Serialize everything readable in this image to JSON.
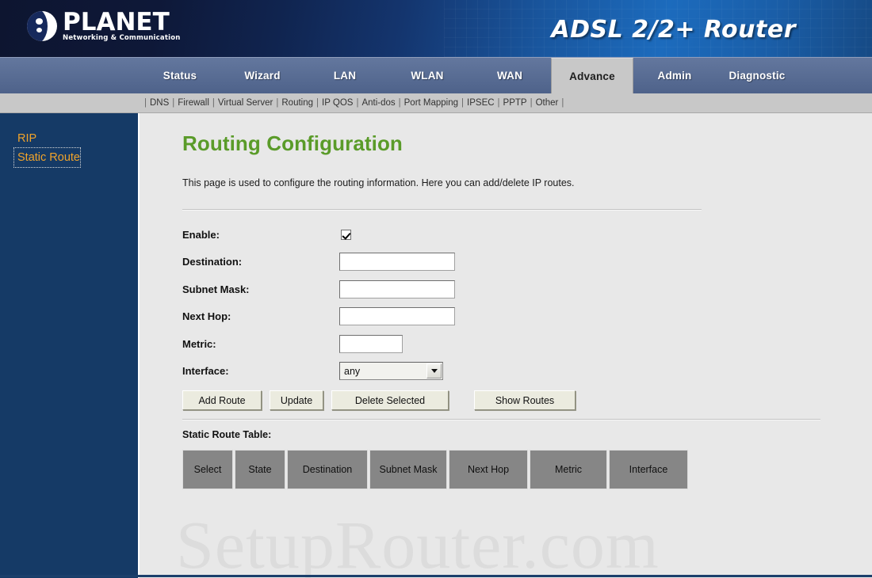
{
  "masthead": {
    "logo_word": "PLANET",
    "logo_tagline": "Networking & Communication",
    "product_title": "ADSL 2/2+ Router",
    "brand_color": "#16295c"
  },
  "nav": {
    "tabs": [
      {
        "label": "Status",
        "active": false
      },
      {
        "label": "Wizard",
        "active": false
      },
      {
        "label": "LAN",
        "active": false
      },
      {
        "label": "WLAN",
        "active": false
      },
      {
        "label": "WAN",
        "active": false
      },
      {
        "label": "Advance",
        "active": true
      },
      {
        "label": "Admin",
        "active": false
      },
      {
        "label": "Diagnostic",
        "active": false
      }
    ]
  },
  "subnav": {
    "leading_separator": "|",
    "items": [
      "DNS",
      "Firewall",
      "Virtual Server",
      "Routing",
      "IP QOS",
      "Anti-dos",
      "Port Mapping",
      "IPSEC",
      "PPTP",
      "Other"
    ],
    "separator": "|"
  },
  "sidebar": {
    "items": [
      {
        "label": "RIP",
        "focused": false
      },
      {
        "label": "Static Route",
        "focused": true
      }
    ],
    "link_color": "#f0a32a",
    "background_color": "#153a66"
  },
  "main": {
    "title": "Routing Configuration",
    "title_color": "#5a9b29",
    "intro": "This page is used to configure the routing information. Here you can add/delete IP routes.",
    "form": {
      "enable": {
        "label": "Enable:",
        "checked": true
      },
      "destination": {
        "label": "Destination:",
        "value": "",
        "placeholder": ""
      },
      "subnet_mask": {
        "label": "Subnet Mask:",
        "value": "",
        "placeholder": ""
      },
      "next_hop": {
        "label": "Next Hop:",
        "value": "",
        "placeholder": ""
      },
      "metric": {
        "label": "Metric:",
        "value": "",
        "placeholder": ""
      },
      "interface": {
        "label": "Interface:",
        "selected": "any",
        "options": [
          "any"
        ]
      }
    },
    "buttons": {
      "add_route": "Add Route",
      "update": "Update",
      "delete_selected": "Delete Selected",
      "show_routes": "Show Routes"
    },
    "table": {
      "caption": "Static Route Table:",
      "headers": [
        "Select",
        "State",
        "Destination",
        "Subnet Mask",
        "Next Hop",
        "Metric",
        "Interface"
      ],
      "rows": []
    }
  },
  "watermark": {
    "text": "SetupRouter.com"
  }
}
